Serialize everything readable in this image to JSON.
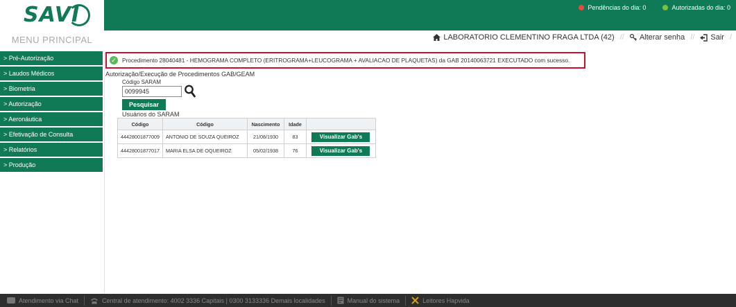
{
  "header": {
    "logo_text": "SAVI",
    "pendencias": "Pendências do dia: 0",
    "autorizadas": "Autorizadas do dia: 0",
    "menu_title": "MENU PRINCIPAL",
    "lab_name": "LABORATORIO CLEMENTINO FRAGA LTDA (42)",
    "alterar_senha": "Alterar senha",
    "sair": "Sair"
  },
  "sidebar": {
    "items": [
      {
        "label": "> Pré-Autorização"
      },
      {
        "label": "> Laudos Médicos"
      },
      {
        "label": "> Biometria"
      },
      {
        "label": "> Autorização"
      },
      {
        "label": "> Aeronáutica"
      },
      {
        "label": "> Efetivação de Consulta"
      },
      {
        "label": "> Relatórios"
      },
      {
        "label": "> Produção"
      }
    ]
  },
  "main": {
    "success_message": "Procedimento 28040481 - HEMOGRAMA COMPLETO (ERITROGRAMA+LEUCOGRAMA + AVALIACAO DE PLAQUETAS) da GAB 20140063721 EXECUTADO com sucesso.",
    "section_title": "Autorização/Execução de Procedimentos GAB/GEAM",
    "field_label": "Código SARAM",
    "field_value": "0099945",
    "search_button": "Pesquisar",
    "users_label": "Usuários do SARAM",
    "table": {
      "headers": [
        "Código",
        "Código",
        "Nascimento",
        "Idade",
        ""
      ],
      "rows": [
        {
          "codigo": "44428001877009",
          "nome": "ANTONIO DE SOUZA QUEIROZ",
          "nascimento": "21/08/1930",
          "idade": "83",
          "action": "Visualizar Gab's"
        },
        {
          "codigo": "44428001877017",
          "nome": "MARIA ELSA DE OQUEIROZ",
          "nascimento": "05/02/1938",
          "idade": "76",
          "action": "Visualizar Gab's"
        }
      ]
    }
  },
  "footer": {
    "chat": "Atendimento via Chat",
    "central": "Central de atendimento: 4002 3336 Capitais | 0300 3133336 Demais localidades",
    "manual": "Manual do sistema",
    "leitores": "Leitores Hapvida"
  },
  "colors": {
    "brand_green": "#0f7a55",
    "alert_red": "#c8102e",
    "footer_bg": "#2e2e2e"
  }
}
